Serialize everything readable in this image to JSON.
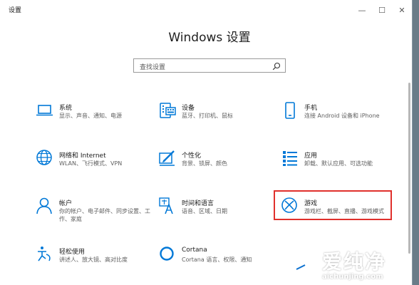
{
  "window": {
    "title": "设置"
  },
  "window_controls": {
    "minimize": "—",
    "maximize": "☐",
    "close": "✕"
  },
  "header": {
    "title": "Windows 设置"
  },
  "search": {
    "placeholder": "查找设置"
  },
  "tiles": [
    {
      "title": "系统",
      "desc": "显示、声音、通知、电源",
      "icon": "laptop-icon"
    },
    {
      "title": "设备",
      "desc": "蓝牙、打印机、鼠标",
      "icon": "keyboard-icon"
    },
    {
      "title": "手机",
      "desc": "连接 Android 设备和 iPhone",
      "icon": "phone-icon"
    },
    {
      "title": "网络和 Internet",
      "desc": "WLAN、飞行模式、VPN",
      "icon": "globe-icon"
    },
    {
      "title": "个性化",
      "desc": "背景、锁屏、颜色",
      "icon": "paintbrush-icon"
    },
    {
      "title": "应用",
      "desc": "卸载、默认应用、可选功能",
      "icon": "apps-list-icon"
    },
    {
      "title": "帐户",
      "desc": "你的帐户、电子邮件、同步设置、工作、家庭",
      "icon": "person-icon"
    },
    {
      "title": "时间和语言",
      "desc": "语音、区域、日期",
      "icon": "language-icon"
    },
    {
      "title": "游戏",
      "desc": "游戏栏、截屏、直播、游戏模式",
      "icon": "xbox-icon"
    },
    {
      "title": "轻松使用",
      "desc": "讲述人、放大镜、高对比度",
      "icon": "accessibility-icon"
    },
    {
      "title": "Cortana",
      "desc": "Cortana 语言、权限、通知",
      "icon": "cortana-icon"
    }
  ],
  "accent_color": "#0078d7",
  "highlight_color": "#e0302c",
  "watermark": {
    "brand_cn": "爱纯净",
    "url": "aichunjing.com"
  }
}
